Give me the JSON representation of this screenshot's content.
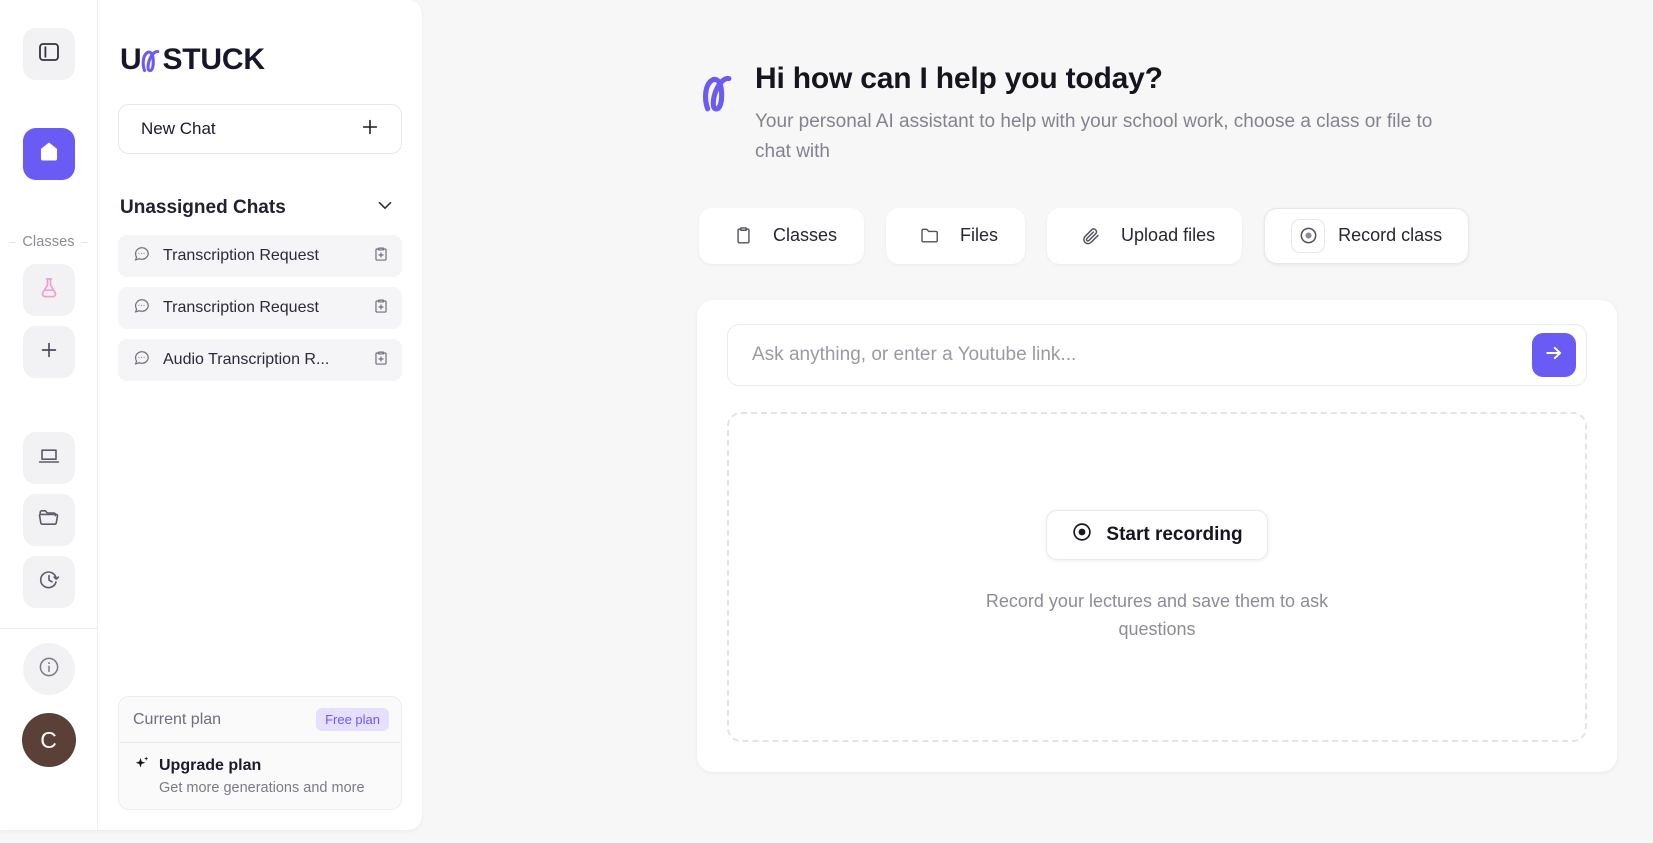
{
  "brand": {
    "name_prefix": "U",
    "name_suffix": "STUCK",
    "mark": "unstuck-loop-mark",
    "accent": "#6b5bf5"
  },
  "rail": {
    "classes_label": "Classes",
    "items": [
      {
        "name": "sidebar-toggle",
        "icon": "panel-left-icon",
        "active": false
      },
      {
        "name": "home",
        "icon": "home-icon",
        "active": true
      },
      {
        "name": "class-chemistry",
        "icon": "flask-icon",
        "active": false
      },
      {
        "name": "add-class",
        "icon": "plus-icon",
        "active": false
      },
      {
        "name": "device",
        "icon": "laptop-icon",
        "active": false
      },
      {
        "name": "files",
        "icon": "folder-icon",
        "active": false
      },
      {
        "name": "history",
        "icon": "clock-history-icon",
        "active": false
      },
      {
        "name": "info",
        "icon": "info-icon",
        "active": false
      }
    ],
    "avatar_initial": "C",
    "avatar_color": "#5a4036"
  },
  "sidebar": {
    "new_chat_label": "New Chat",
    "new_chat_icon": "plus-icon",
    "section_title": "Unassigned Chats",
    "section_chevron": "chevron-down-icon",
    "chats": [
      {
        "label": "Transcription Request",
        "icon": "chat-bubble-icon",
        "action_icon": "clipboard-plus-icon"
      },
      {
        "label": "Transcription Request",
        "icon": "chat-bubble-icon",
        "action_icon": "clipboard-plus-icon"
      },
      {
        "label": "Audio Transcription R...",
        "icon": "chat-bubble-icon",
        "action_icon": "clipboard-plus-icon"
      }
    ],
    "plan": {
      "current_label": "Current plan",
      "badge": "Free plan",
      "badge_color": "#6b5bf5",
      "upgrade_title": "Upgrade plan",
      "upgrade_sub": "Get more generations and more",
      "upgrade_icon": "sparkles-icon"
    }
  },
  "main": {
    "greeting_title": "Hi how can I help you today?",
    "greeting_sub": "Your personal AI assistant to help with your school work, choose a class or file to chat with",
    "actions": [
      {
        "label": "Classes",
        "icon": "clipboard-icon",
        "selected": false
      },
      {
        "label": "Files",
        "icon": "folder-icon",
        "selected": false
      },
      {
        "label": "Upload files",
        "icon": "paperclip-icon",
        "selected": false
      },
      {
        "label": "Record class",
        "icon": "record-circle-icon",
        "selected": true
      }
    ],
    "composer": {
      "placeholder": "Ask anything, or enter a Youtube link...",
      "value": "",
      "send_icon": "arrow-right-icon"
    },
    "record_zone": {
      "button_label": "Start recording",
      "button_icon": "record-circle-icon",
      "hint": "Record your lectures and save them to ask questions"
    }
  }
}
